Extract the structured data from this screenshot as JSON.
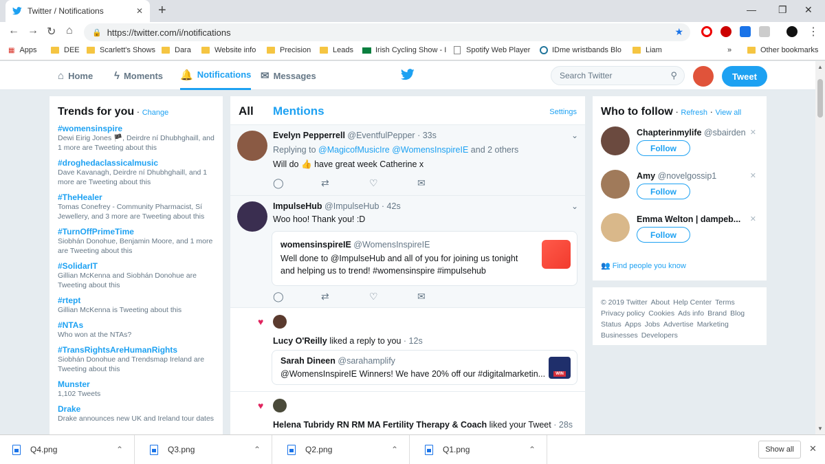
{
  "browser": {
    "tab_title": "Twitter / Notifications",
    "url": "https://twitter.com/i/notifications",
    "bookmarks": [
      "Apps",
      "DEE",
      "Scarlett's Shows",
      "Dara",
      "Website info",
      "Precision",
      "Leads",
      "Irish Cycling Show - I",
      "Spotify Web Player",
      "IDme wristbands Blo",
      "Liam",
      "Other bookmarks"
    ],
    "overflow": "»"
  },
  "twitter_nav": {
    "home": "Home",
    "moments": "Moments",
    "notifications": "Notifications",
    "messages": "Messages",
    "search_placeholder": "Search Twitter",
    "tweet_button": "Tweet"
  },
  "trends": {
    "title": "Trends for you",
    "change": "Change",
    "items": [
      {
        "tag": "#womensinspire",
        "context": "Dewi Eirig Jones 🏴, Deirdre ní Dhubhghaill, and 1 more are Tweeting about this"
      },
      {
        "tag": "#droghedaclassicalmusic",
        "context": "Dave Kavanagh, Deirdre ní Dhubhghaill, and 1 more are Tweeting about this"
      },
      {
        "tag": "#TheHealer",
        "context": "Tomas Conefrey - Community Pharmacist, Sí Jewellery, and 3 more are Tweeting about this"
      },
      {
        "tag": "#TurnOffPrimeTime",
        "context": "Siobhán Donohue, Benjamin Moore, and 1 more are Tweeting about this"
      },
      {
        "tag": "#SolidarIT",
        "context": "Gillian McKenna and Siobhán Donohue are Tweeting about this"
      },
      {
        "tag": "#rtept",
        "context": "Gillian McKenna is Tweeting about this"
      },
      {
        "tag": "#NTAs",
        "context": "Who won at the NTAs?"
      },
      {
        "tag": "#TransRightsAreHumanRights",
        "context": "Siobhán Donohue and Trendsmap Ireland are Tweeting about this"
      },
      {
        "tag": "Munster",
        "context": "1,102 Tweets"
      },
      {
        "tag": "Drake",
        "context": "Drake announces new UK and Ireland tour dates"
      }
    ]
  },
  "stream": {
    "tab_all": "All",
    "tab_mentions": "Mentions",
    "settings": "Settings",
    "n1": {
      "name": "Evelyn Pepperrell",
      "handle": "@EventfulPepper",
      "time": "· 33s",
      "replying": "Replying to",
      "reply_handles": "@MagicofMusicIre @WomensInspireIE",
      "reply_more": "and 2 others",
      "text_a": "Will do",
      "emoji": "👍",
      "text_b": "have great week Catherine x"
    },
    "n2": {
      "name": "ImpulseHub",
      "handle": "@ImpulseHub",
      "time": "· 42s",
      "text": "Woo hoo! Thank you! :D",
      "quote_name": "womensinspireIE",
      "quote_handle": "@WomensInspireIE",
      "quote_line1": "Well done to @ImpulseHub and all of you for joining us tonight",
      "quote_line2": "and helping us to trend! #womensinspire #impulsehub"
    },
    "n3": {
      "actor": "Lucy O'Reilly",
      "action": "liked a reply to you",
      "time": "· 12s",
      "quote_name": "Sarah Dineen",
      "quote_handle": "@sarahamplify",
      "quote_text": "@WomensInspireIE Winners! We have 20% off our #digitalmarketin...",
      "thumb_text": "WIN"
    },
    "n4": {
      "actor": "Helena Tubridy RN RM MA Fertility Therapy & Coach",
      "action": "liked your Tweet",
      "time": "· 28s"
    }
  },
  "who_to_follow": {
    "title": "Who to follow",
    "refresh": "Refresh",
    "view_all": "View all",
    "follow_label": "Follow",
    "people": [
      {
        "name": "Chapterinmylife",
        "handle": "@sbairden"
      },
      {
        "name": "Amy",
        "handle": "@novelgossip1"
      },
      {
        "name": "Emma Welton | dampeb...",
        "handle": ""
      }
    ],
    "find_people": "Find people you know"
  },
  "footer": {
    "links": [
      "© 2019 Twitter",
      "About",
      "Help Center",
      "Terms",
      "Privacy policy",
      "Cookies",
      "Ads info",
      "Brand",
      "Blog",
      "Status",
      "Apps",
      "Jobs",
      "Advertise",
      "Marketing",
      "Businesses",
      "Developers"
    ]
  },
  "downloads": {
    "files": [
      "Q4.png",
      "Q3.png",
      "Q2.png",
      "Q1.png"
    ],
    "show_all": "Show all"
  },
  "colors": {
    "accent": "#1da1f2",
    "like": "#e0245e",
    "background": "#e6ecf0"
  }
}
